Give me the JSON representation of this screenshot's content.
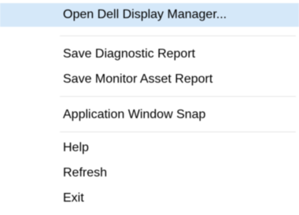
{
  "menu": {
    "highlight_color": "#d5e8f9",
    "items": [
      {
        "label": "Open Dell Display Manager...",
        "highlighted": true
      },
      {
        "label": "Save Diagnostic Report",
        "highlighted": false
      },
      {
        "label": "Save Monitor Asset Report",
        "highlighted": false
      },
      {
        "label": "Application Window Snap",
        "highlighted": false
      },
      {
        "label": "Help",
        "highlighted": false
      },
      {
        "label": "Refresh",
        "highlighted": false
      },
      {
        "label": "Exit",
        "highlighted": false
      }
    ]
  }
}
